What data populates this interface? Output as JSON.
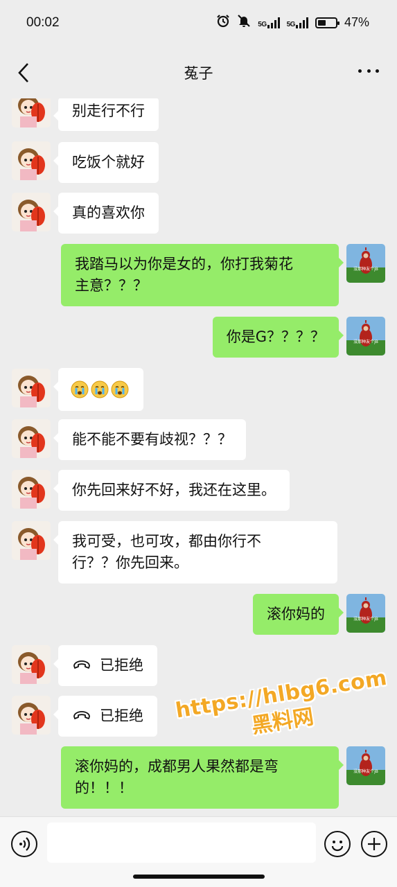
{
  "status_bar": {
    "time": "00:02",
    "battery": "47%",
    "battery_level": 0.47,
    "network_1": "5G",
    "network_2": "5G",
    "icons": [
      "alarm-icon",
      "mute-icon",
      "signal-icon",
      "battery-icon"
    ]
  },
  "header": {
    "title": "菟子"
  },
  "messages": [
    {
      "side": "left",
      "text": "别走行不行"
    },
    {
      "side": "left",
      "text": "吃饭个就好"
    },
    {
      "side": "left",
      "text": "真的喜欢你"
    },
    {
      "side": "right",
      "line1": "我踏马以为你是女的，你打我菊花",
      "line2": "主意？？？"
    },
    {
      "side": "right",
      "text": "你是G？？？？"
    },
    {
      "side": "left",
      "type": "emoji",
      "emoji_count": 3,
      "emoji_name": "crying-face-emoji"
    },
    {
      "side": "left",
      "text": "能不能不要有歧视？？？"
    },
    {
      "side": "left",
      "text": "你先回来好不好，我还在这里。"
    },
    {
      "side": "left",
      "line1": "我可受，也可攻，都由你行不",
      "line2": "行？？你先回来。"
    },
    {
      "side": "right",
      "text": "滚你妈的"
    },
    {
      "side": "left",
      "type": "call",
      "text": "已拒绝",
      "icon": "phone-hangup-icon"
    },
    {
      "side": "left",
      "type": "call",
      "text": "已拒绝",
      "icon": "phone-hangup-icon"
    },
    {
      "side": "right",
      "line1": "滚你妈的，成都男人果然都是弯",
      "line2": "的！！！"
    }
  ],
  "avatar_right_caption": "没那种友个jB",
  "watermark": {
    "url": "https://hlbg6.com",
    "site": "黑料网"
  },
  "input": {
    "placeholder": ""
  },
  "colors": {
    "background": "#ededed",
    "bubble_self": "#95ec69",
    "bubble_other": "#ffffff",
    "watermark": "#f3a825"
  }
}
